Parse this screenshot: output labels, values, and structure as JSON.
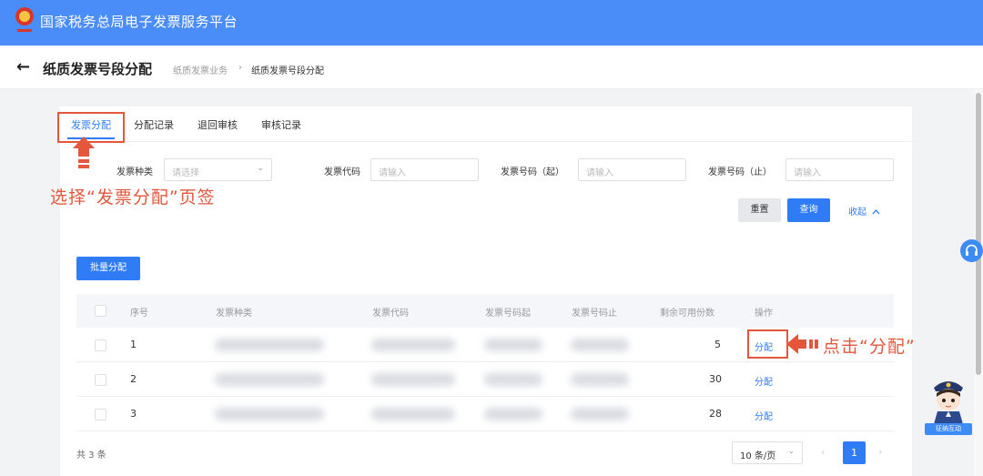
{
  "app": {
    "title": "国家税务总局电子发票服务平台"
  },
  "subheader": {
    "back_icon": "←",
    "page_title": "纸质发票号段分配",
    "breadcrumb": [
      "纸质发票业务",
      "纸质发票号段分配"
    ],
    "separator": "›"
  },
  "tabs": [
    {
      "label": "发票分配",
      "active": true
    },
    {
      "label": "分配记录",
      "active": false
    },
    {
      "label": "退回审核",
      "active": false
    },
    {
      "label": "审核记录",
      "active": false
    }
  ],
  "filters": {
    "invoice_type": {
      "label": "发票种类",
      "placeholder": "请选择"
    },
    "invoice_code": {
      "label": "发票代码",
      "placeholder": "请输入"
    },
    "number_start": {
      "label": "发票号码（起）",
      "placeholder": "请输入"
    },
    "number_end": {
      "label": "发票号码（止）",
      "placeholder": "请输入"
    }
  },
  "buttons": {
    "reset": "重置",
    "query": "查询",
    "collapse": "收起",
    "batch_assign": "批量分配"
  },
  "table": {
    "columns": [
      "序号",
      "发票种类",
      "发票代码",
      "发票号码起",
      "发票号码止",
      "剩余可用份数",
      "操作"
    ],
    "rows": [
      {
        "index": "1",
        "remaining": "5",
        "action": "分配"
      },
      {
        "index": "2",
        "remaining": "30",
        "action": "分配"
      },
      {
        "index": "3",
        "remaining": "28",
        "action": "分配"
      }
    ]
  },
  "pagination": {
    "total": "共 3 条",
    "page_size": "10 条/页",
    "current_page": "1",
    "prev_icon": "‹",
    "next_icon": "›",
    "chevron": "⌄"
  },
  "annotations": {
    "tab_hint": "选择“发票分配”页签",
    "action_hint": "点击“分配”"
  },
  "widgets": {
    "mascot_label": "征纳互动"
  },
  "colors": {
    "brand": "#4b8df8",
    "accent": "#2f7cf6",
    "annotation": "#e4573d"
  }
}
